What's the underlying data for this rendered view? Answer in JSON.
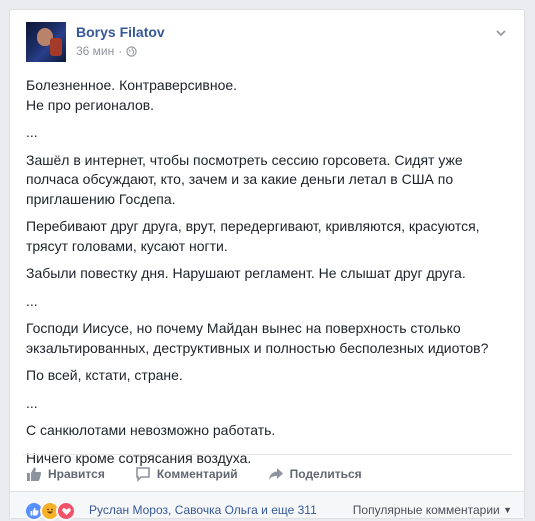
{
  "post": {
    "author": "Borys Filatov",
    "time": "36 мин",
    "paragraphs": [
      "Болезненное. Контраверсивное.\nНе про регионалов.",
      "...",
      "Зашёл в интернет, чтобы посмотреть сессию горсовета. Сидят уже полчаса обсуждают, кто, зачем и за какие деньги летал в США по приглашению Госдепа.",
      "Перебивают друг друга, врут, передергивают, кривляются, красуются, трясут головами, кусают ногти.",
      "Забыли повестку дня. Нарушают регламент. Не слышат друг друга.",
      "...",
      "Господи Иисусе, но почему Майдан вынес на поверхность столько экзальтированных, деструктивных и полностью бесполезных идиотов?",
      "По всей, кстати, стране.",
      "...",
      "С санкюлотами невозможно работать.",
      "Ничего кроме сотрясания воздуха."
    ]
  },
  "actions": {
    "like": "Нравится",
    "comment": "Комментарий",
    "share": "Поделиться"
  },
  "footer": {
    "reactors": "Руслан Мороз, Савочка Ольга и еще 311",
    "sort": "Популярные комментарии",
    "reaction_icons": [
      "like-icon",
      "haha-icon",
      "love-icon"
    ]
  },
  "colors": {
    "link": "#365899",
    "muted": "#90949c",
    "action": "#616770"
  }
}
